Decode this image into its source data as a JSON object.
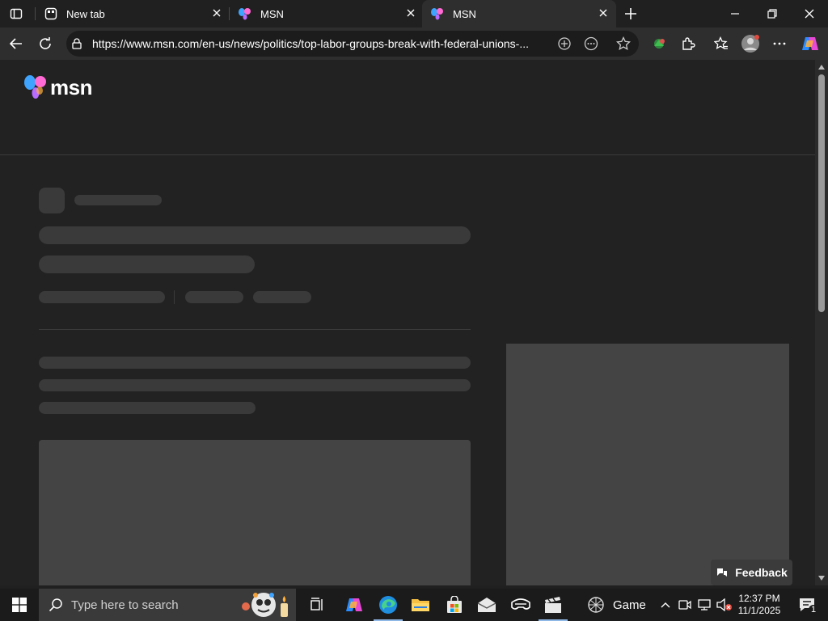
{
  "browser": {
    "tabs": [
      {
        "title": "New tab",
        "favicon": "newtab-icon",
        "active": false
      },
      {
        "title": "MSN",
        "favicon": "msn-butterfly-icon",
        "active": false
      },
      {
        "title": "MSN",
        "favicon": "msn-butterfly-icon",
        "active": true
      }
    ],
    "address_url": "https://www.msn.com/en-us/news/politics/top-labor-groups-break-with-federal-unions-...",
    "accent_color": "#8fb8e6"
  },
  "page": {
    "logo_text": "msn",
    "feedback_label": "Feedback"
  },
  "taskbar": {
    "search_placeholder": "Type here to search",
    "game_label": "Game",
    "time": "12:37 PM",
    "date": "11/1/2025",
    "notification_count": "1"
  }
}
